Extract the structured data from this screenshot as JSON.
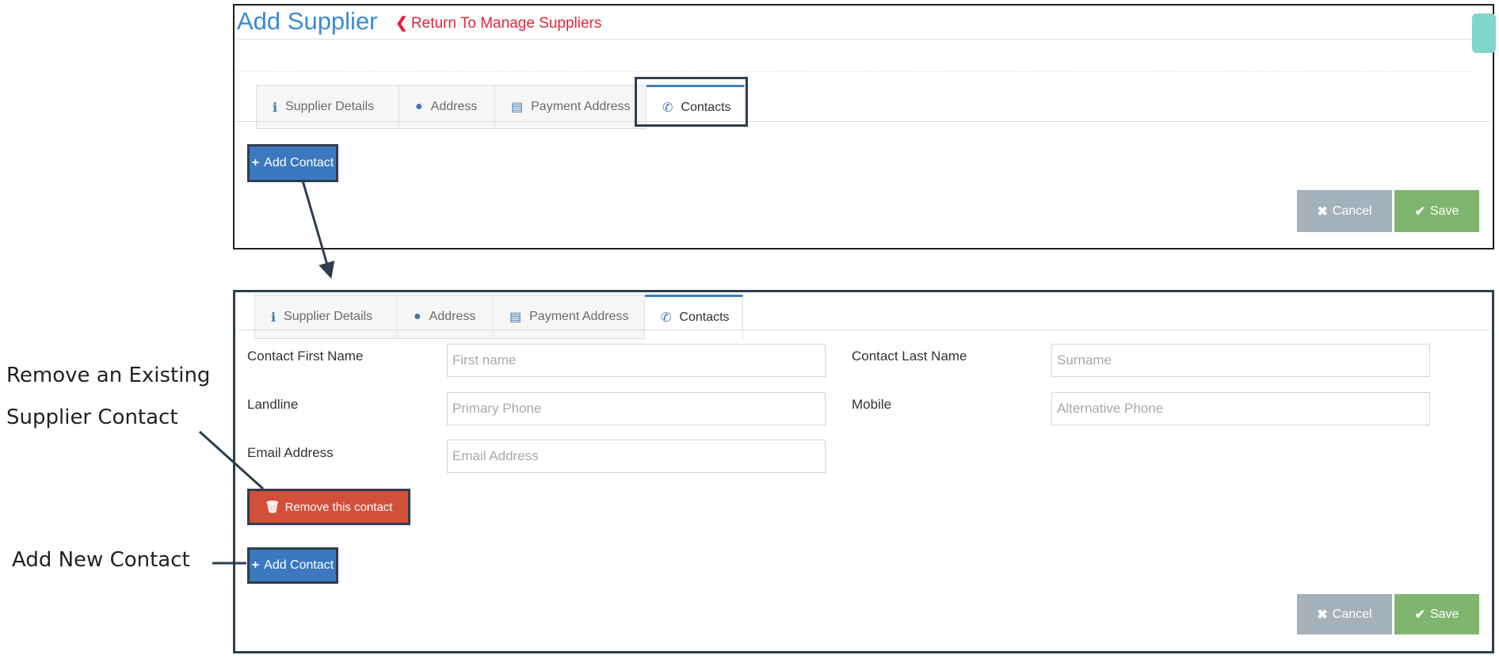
{
  "header": {
    "title": "Add Supplier",
    "return_link": "Return To Manage Suppliers"
  },
  "tabs": [
    {
      "label": "Supplier Details",
      "icon": "info-icon"
    },
    {
      "label": "Address",
      "icon": "globe-icon"
    },
    {
      "label": "Payment Address",
      "icon": "credit-card-icon"
    },
    {
      "label": "Contacts",
      "icon": "phone-icon",
      "active": true
    }
  ],
  "buttons": {
    "add_contact": "Add Contact",
    "cancel": "Cancel",
    "save": "Save",
    "remove_contact": "Remove this contact"
  },
  "form": {
    "first_name": {
      "label": "Contact First Name",
      "placeholder": "First name",
      "value": ""
    },
    "last_name": {
      "label": "Contact Last Name",
      "placeholder": "Surname",
      "value": ""
    },
    "landline": {
      "label": "Landline",
      "placeholder": "Primary Phone",
      "value": ""
    },
    "mobile": {
      "label": "Mobile",
      "placeholder": "Alternative Phone",
      "value": ""
    },
    "email": {
      "label": "Email Address",
      "placeholder": "Email Address",
      "value": ""
    }
  },
  "annotations": {
    "remove_line1": "Remove an Existing",
    "remove_line2": "Supplier Contact",
    "add_new": "Add New Contact"
  },
  "colors": {
    "title_blue": "#3a8ad6",
    "link_red": "#e3243b",
    "primary_blue": "#3b78c0",
    "danger_red": "#d24f3a",
    "cancel_grey": "#a4b1ba",
    "save_green": "#7fb56f",
    "frame_dark": "#2f3d4f"
  }
}
